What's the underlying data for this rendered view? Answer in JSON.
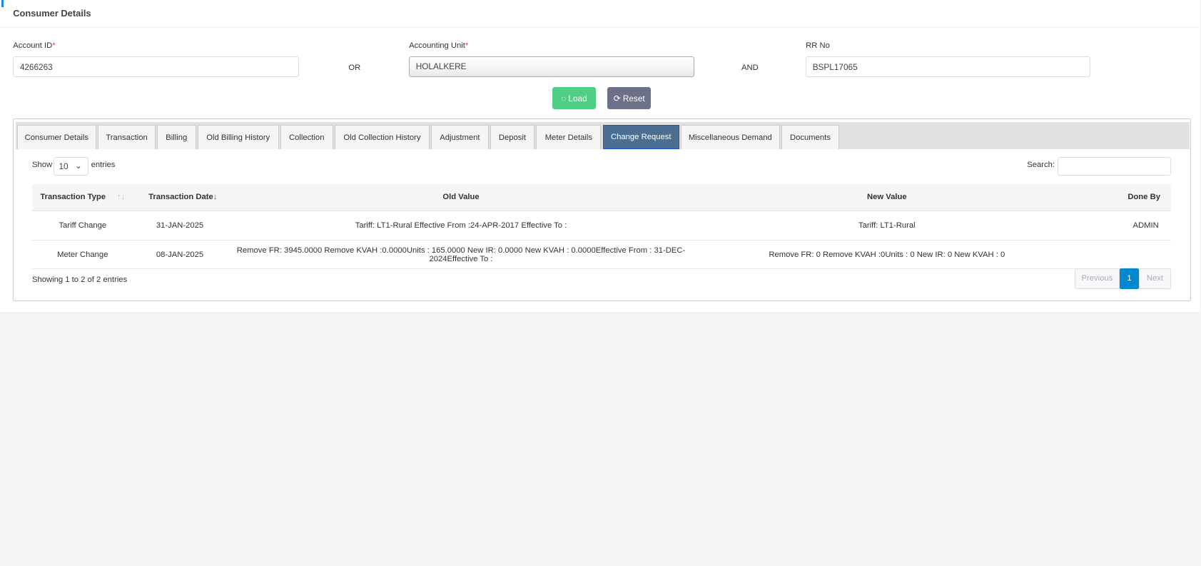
{
  "header": {
    "title": "Consumer Details"
  },
  "form": {
    "account_id": {
      "label": "Account ID",
      "required": "*",
      "value": "4266263"
    },
    "or_label": "OR",
    "accounting_unit": {
      "label": "Accounting Unit",
      "required": "*",
      "value": "HOLALKERE"
    },
    "and_label": "AND",
    "rr_no": {
      "label": "RR No",
      "value": "BSPL17065"
    },
    "load_label": "Load",
    "reset_label": "Reset"
  },
  "tabs": [
    "Consumer Details",
    "Transaction",
    "Billing",
    "Old Billing History",
    "Collection",
    "Old Collection History",
    "Adjustment",
    "Deposit",
    "Meter Details",
    "Change Request",
    "Miscellaneous Demand",
    "Documents"
  ],
  "active_tab": "Change Request",
  "table": {
    "show_label": "Show",
    "entries_label": "entries",
    "page_size": "10",
    "search_label": "Search:",
    "search_value": "",
    "columns": [
      "Transaction Type",
      "Transaction Date",
      "Old Value",
      "New Value",
      "Done By"
    ],
    "rows": [
      [
        "Tariff Change",
        "31-JAN-2025",
        "Tariff: LT1-Rural Effective From :24-APR-2017 Effective To :",
        "Tariff: LT1-Rural",
        "ADMIN"
      ],
      [
        "Meter Change",
        "08-JAN-2025",
        "Remove FR: 3945.0000 Remove KVAH :0.0000Units : 165.0000 New IR: 0.0000 New KVAH : 0.0000Effective From : 31-DEC-2024Effective To :",
        "Remove FR: 0 Remove KVAH :0Units : 0 New IR: 0 New KVAH : 0",
        ""
      ]
    ],
    "info": "Showing 1 to 2 of 2 entries",
    "pagination": {
      "previous": "Previous",
      "current": "1",
      "next": "Next"
    }
  },
  "colors": {
    "accent": "#1e88e5",
    "load": "#4fce85",
    "reset": "#6c7189",
    "active_tab": "#4a6f93",
    "page_active": "#0288d1"
  }
}
